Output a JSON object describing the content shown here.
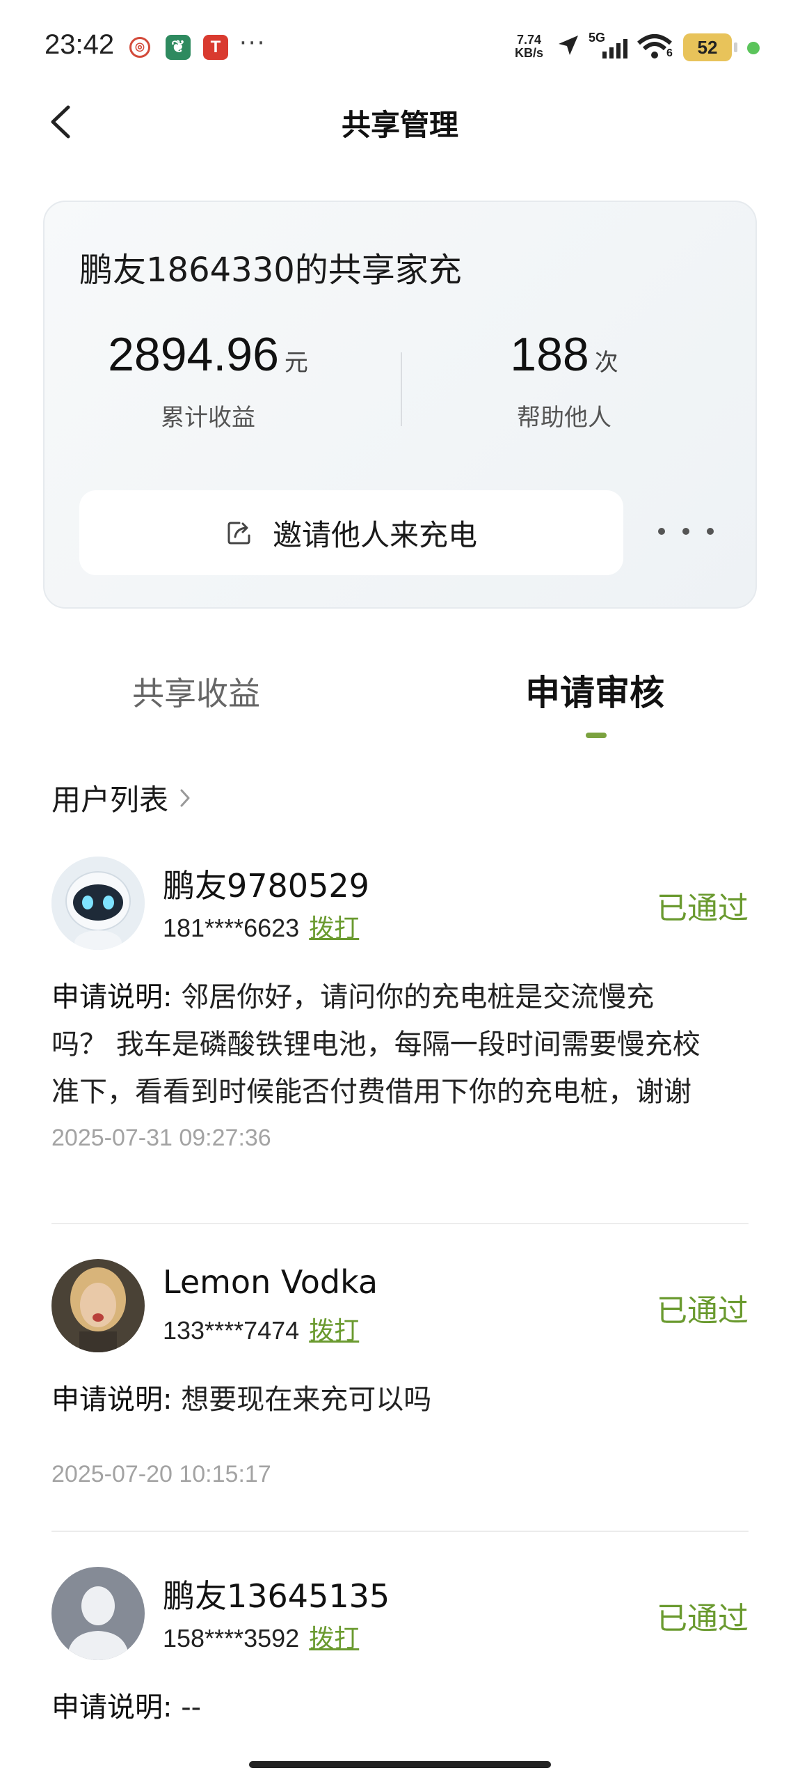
{
  "status_bar": {
    "time": "23:42",
    "app_icons": [
      "red-seal-icon",
      "green-leaf-icon",
      "red-t-icon"
    ],
    "more": "···",
    "speed_value": "7.74",
    "speed_unit": "KB/s",
    "network": "5G",
    "wifi_sub": "6",
    "battery": "52"
  },
  "nav": {
    "title": "共享管理"
  },
  "summary": {
    "title": "鹏友1864330的共享家充",
    "earnings_value": "2894.96",
    "earnings_unit": "元",
    "earnings_label": "累计收益",
    "helped_value": "188",
    "helped_unit": "次",
    "helped_label": "帮助他人",
    "invite_label": "邀请他人来充电"
  },
  "tabs": [
    {
      "label": "共享收益",
      "active": false
    },
    {
      "label": "申请审核",
      "active": true
    }
  ],
  "user_list": {
    "label": "用户列表"
  },
  "entries": [
    {
      "name": "鹏友9780529",
      "phone": "181****6623",
      "call_label": "拨打",
      "status": "已通过",
      "desc_label": "申请说明:",
      "desc_lines": [
        "邻居你好，请问你的充电桩是交流慢充",
        "吗？ 我车是磷酸铁锂电池，每隔一段时间需要慢充校",
        "准下，看看到时候能否付费借用下你的充电桩，谢谢"
      ],
      "time": "2025-07-31 09:27:36"
    },
    {
      "name": "Lemon Vodka",
      "phone": "133****7474",
      "call_label": "拨打",
      "status": "已通过",
      "desc_label": "申请说明:",
      "desc_text": "想要现在来充可以吗",
      "time": "2025-07-20 10:15:17"
    },
    {
      "name": "鹏友13645135",
      "phone": "158****3592",
      "call_label": "拨打",
      "status": "已通过",
      "desc_label": "申请说明:",
      "desc_text": "--"
    }
  ],
  "colors": {
    "accent": "#6a9a2f",
    "tab_indicator": "#7ba23f",
    "timestamp": "#a3a3a3"
  }
}
